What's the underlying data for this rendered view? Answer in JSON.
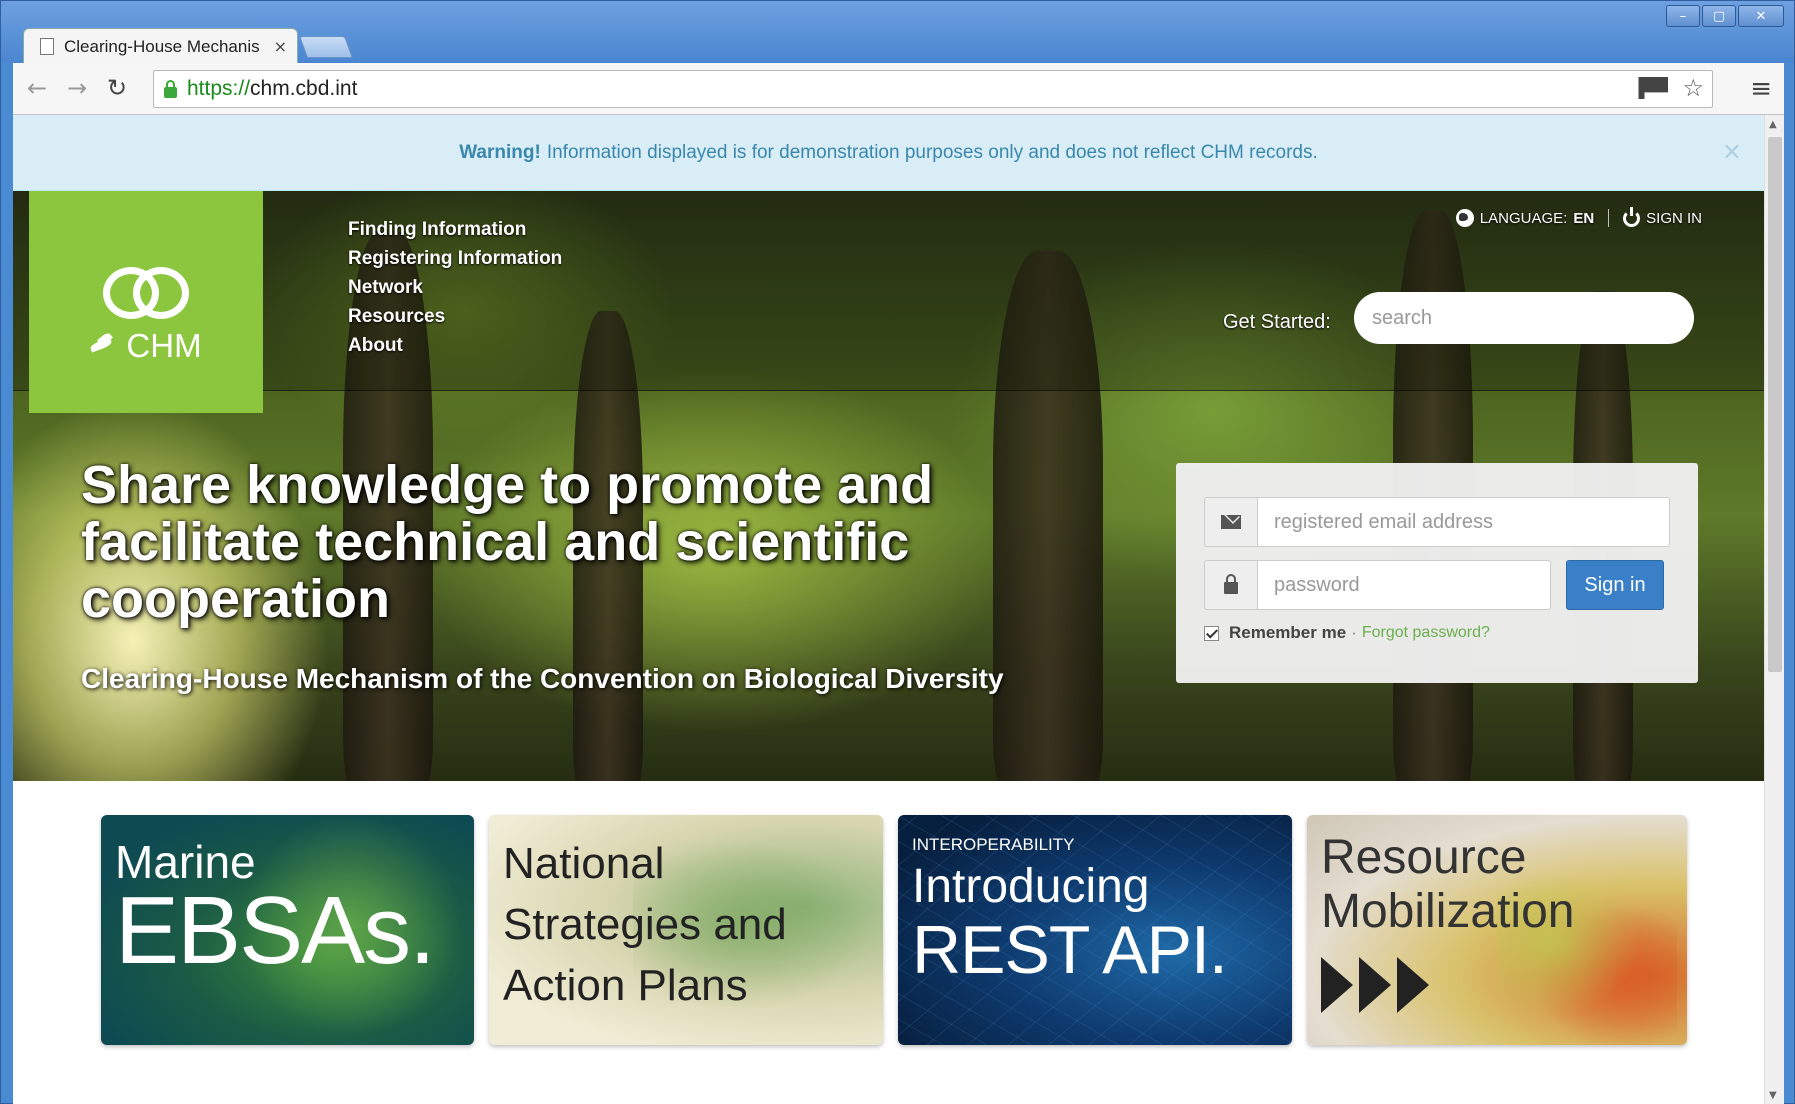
{
  "browser": {
    "tab_title": "Clearing-House Mechanis",
    "tab_close": "×",
    "url_scheme": "https://",
    "url_host": "chm.cbd.int",
    "window_controls": [
      "–",
      "▢",
      "✕"
    ]
  },
  "alert": {
    "strong": "Warning!",
    "message": "Information displayed is for demonstration purposes only and does not reflect CHM records.",
    "close": "×"
  },
  "logo": {
    "text": "CHM"
  },
  "nav": {
    "items": [
      "Finding Information",
      "Registering Information",
      "Network",
      "Resources",
      "About"
    ]
  },
  "util": {
    "language_label": "LANGUAGE:",
    "language_value": "EN",
    "sign_in": "SIGN IN"
  },
  "search": {
    "label": "Get Started:",
    "placeholder": "search"
  },
  "hero": {
    "title": "Share knowledge to promote and facilitate technical and scientific cooperation",
    "subtitle": "Clearing-House Mechanism of the Convention on Biological Diversity"
  },
  "login": {
    "email_placeholder": "registered email address",
    "password_placeholder": "password",
    "submit": "Sign in",
    "remember": "Remember me",
    "separator": "·",
    "forgot": "Forgot password?"
  },
  "tiles": {
    "marine": {
      "small": "Marine",
      "big": "EBSAs."
    },
    "nbsap": {
      "line1": "National",
      "line2": "Strategies and",
      "line3": "Action Plans"
    },
    "api": {
      "kicker": "INTEROPERABILITY",
      "mid": "Introducing",
      "big": "REST API."
    },
    "resource": {
      "line1": "Resource",
      "line2": "Mobilization"
    }
  },
  "colors": {
    "brand_green": "#8cc63e",
    "primary_blue": "#3a80c8",
    "alert_bg": "#d9edf7",
    "alert_text": "#3a87ad"
  },
  "icons": [
    "page-icon",
    "close-icon",
    "back-icon",
    "forward-icon",
    "reload-icon",
    "lock-icon",
    "flag-icon",
    "star-icon",
    "menu-icon",
    "globe-icon",
    "power-icon",
    "envelope-icon",
    "password-lock-icon",
    "checkbox-icon",
    "arrow-icon"
  ]
}
